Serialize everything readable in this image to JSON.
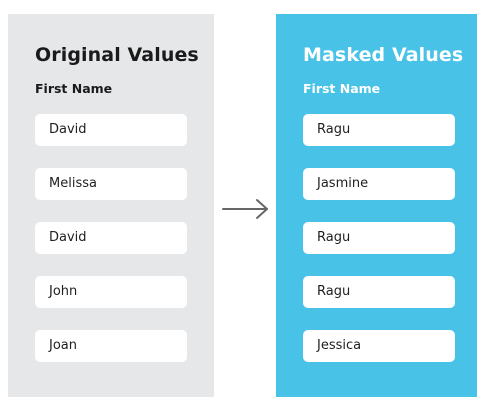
{
  "original": {
    "title": "Original Values",
    "label": "First Name",
    "values": [
      "David",
      "Melissa",
      "David",
      "John",
      "Joan"
    ]
  },
  "masked": {
    "title": "Masked Values",
    "label": "First Name",
    "values": [
      "Ragu",
      "Jasmine",
      "Ragu",
      "Ragu",
      "Jessica"
    ]
  },
  "colors": {
    "original_panel": "#e6e7e9",
    "masked_panel": "#48c3e7",
    "arrow": "#666666"
  },
  "icons": {
    "transform_arrow": "arrow-right-icon"
  }
}
